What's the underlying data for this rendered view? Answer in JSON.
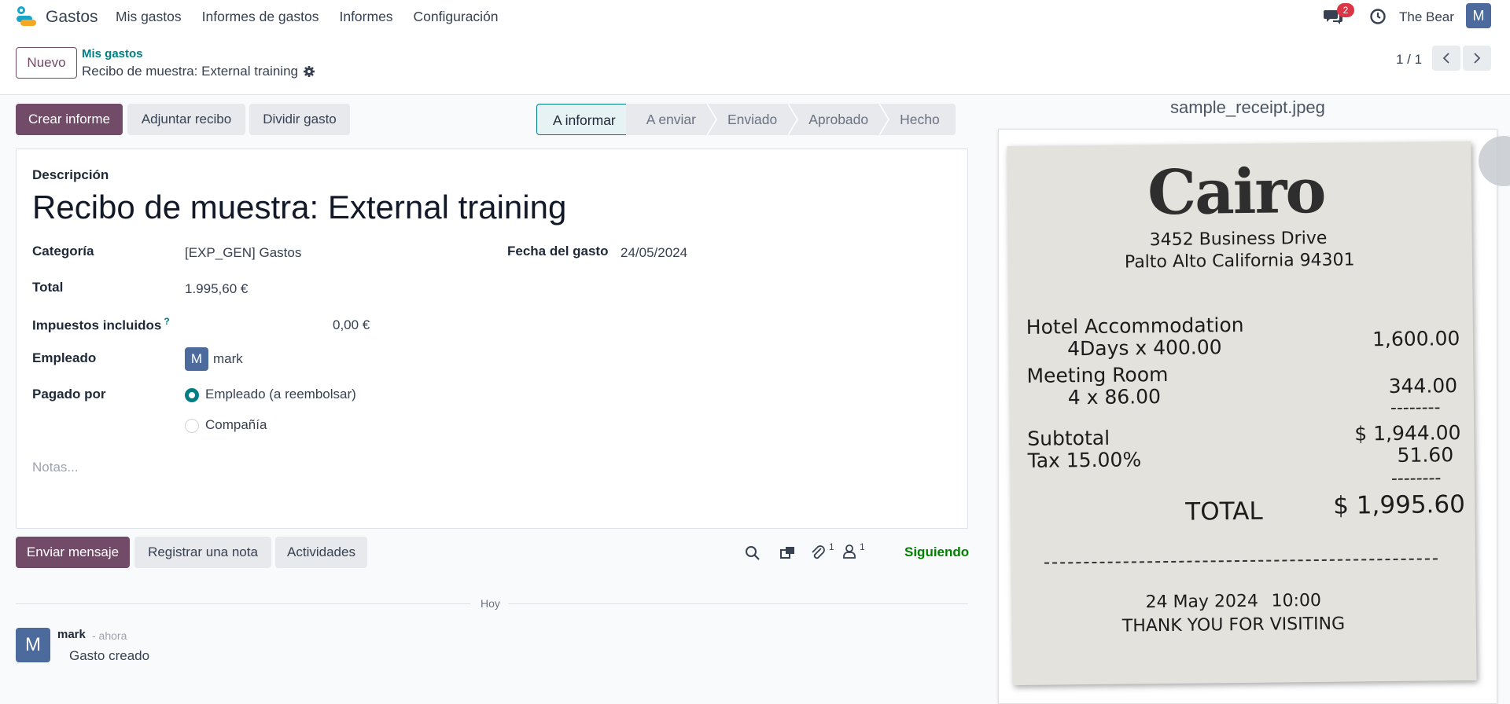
{
  "navbar": {
    "app_name": "Gastos",
    "menu": [
      "Mis gastos",
      "Informes de gastos",
      "Informes",
      "Configuración"
    ],
    "chat_badge": "2",
    "company": "The Bear",
    "user_initial": "M"
  },
  "control_panel": {
    "new_label": "Nuevo",
    "breadcrumb_parent": "Mis gastos",
    "breadcrumb_current": "Recibo de muestra: External training",
    "pager": "1 / 1"
  },
  "actions": {
    "create_report": "Crear informe",
    "attach_receipt": "Adjuntar recibo",
    "split_expense": "Dividir gasto"
  },
  "status_stages": [
    "A informar",
    "A enviar",
    "Enviado",
    "Aprobado",
    "Hecho"
  ],
  "status_active": "A informar",
  "form": {
    "description_label": "Descripción",
    "title": "Recibo de muestra: External training",
    "category_label": "Categoría",
    "category_value": "[EXP_GEN] Gastos",
    "date_label": "Fecha del gasto",
    "date_value": "24/05/2024",
    "total_label": "Total",
    "total_value": "1.995,60 €",
    "tax_label": "Impuestos incluidos",
    "tax_help": "?",
    "tax_value": "0,00 €",
    "employee_label": "Empleado",
    "employee_initial": "M",
    "employee_name": "mark",
    "paid_by_label": "Pagado por",
    "paid_by_options": [
      "Empleado (a reembolsar)",
      "Compañía"
    ],
    "paid_by_selected": "Empleado (a reembolsar)",
    "notes_placeholder": "Notas..."
  },
  "chatter": {
    "send_message": "Enviar mensaje",
    "log_note": "Registrar una nota",
    "activities": "Actividades",
    "attachments_count": "1",
    "followers_count": "1",
    "following": "Siguiendo",
    "separator": "Hoy",
    "message": {
      "author_initial": "M",
      "author": "mark",
      "time": "- ahora",
      "body": "Gasto creado"
    }
  },
  "attachment": {
    "file_name": "sample_receipt.jpeg",
    "receipt": {
      "brand": "Cairo",
      "address_1": "3452 Business Drive",
      "address_2": "Palto Alto California 94301",
      "item_1": "Hotel Accommodation",
      "item_1_detail": "4Days x 400.00",
      "item_1_amount": "1,600.00",
      "item_2": "Meeting Room",
      "item_2_detail": "4 x 86.00",
      "item_2_amount": "344.00",
      "dashes": "--------",
      "subtotal_label": "Subtotal",
      "subtotal_value": "$ 1,944.00",
      "tax_label": "Tax 15.00%",
      "tax_value": "51.60",
      "total_label": "TOTAL",
      "total_value": "$ 1,995.60",
      "date": "24 May 2024",
      "time": "10:00",
      "thanks": "THANK YOU FOR VISITING"
    }
  },
  "colors": {
    "primary": "#714b67",
    "teal": "#017e84",
    "success": "#008000",
    "badge": "#dc3545",
    "avatar": "#4c6a9b"
  }
}
